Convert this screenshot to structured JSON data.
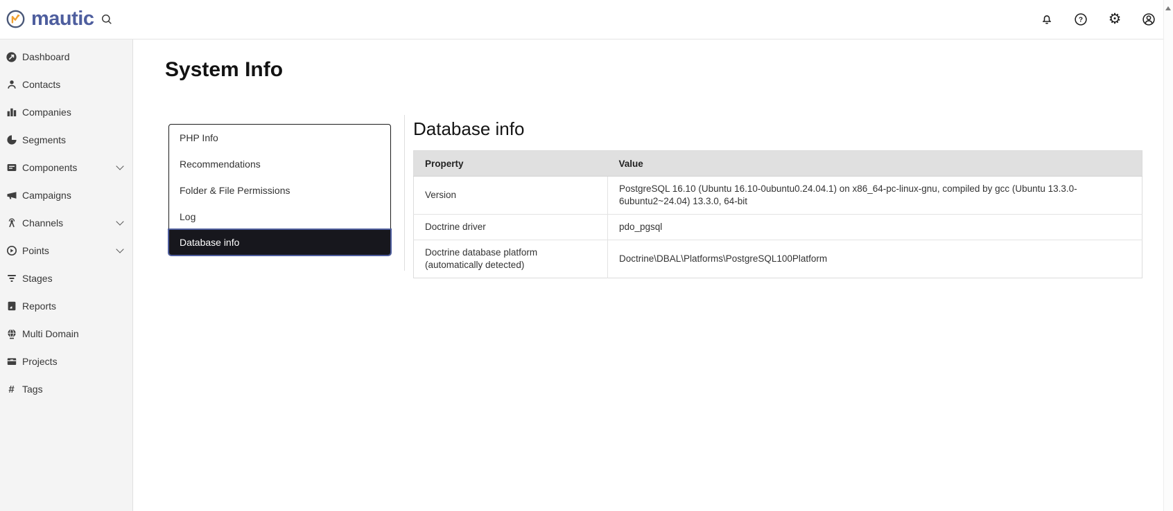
{
  "header": {
    "logo_text": "mautic",
    "icon_names": [
      "search-icon",
      "notifications-bell-icon",
      "help-icon",
      "settings-gear-icon",
      "account-icon"
    ]
  },
  "sidebar": {
    "items": [
      {
        "label": "Dashboard",
        "icon": "dashboard-gauge-icon",
        "has_submenu": false
      },
      {
        "label": "Contacts",
        "icon": "person-icon",
        "has_submenu": false
      },
      {
        "label": "Companies",
        "icon": "bar-chart-icon",
        "has_submenu": false
      },
      {
        "label": "Segments",
        "icon": "pie-chart-icon",
        "has_submenu": false
      },
      {
        "label": "Components",
        "icon": "card-icon",
        "has_submenu": true
      },
      {
        "label": "Campaigns",
        "icon": "megaphone-icon",
        "has_submenu": false
      },
      {
        "label": "Channels",
        "icon": "broadcast-icon",
        "has_submenu": true
      },
      {
        "label": "Points",
        "icon": "circle-arrow-icon",
        "has_submenu": true
      },
      {
        "label": "Stages",
        "icon": "funnel-icon",
        "has_submenu": false
      },
      {
        "label": "Reports",
        "icon": "report-doc-icon",
        "has_submenu": false
      },
      {
        "label": "Multi Domain",
        "icon": "globe-icon",
        "has_submenu": false
      },
      {
        "label": "Projects",
        "icon": "archive-box-icon",
        "has_submenu": false
      },
      {
        "label": "Tags",
        "icon": "hash-icon",
        "has_submenu": false
      }
    ]
  },
  "main": {
    "page_title": "System Info",
    "tabs": [
      {
        "label": "PHP Info",
        "selected": false
      },
      {
        "label": "Recommendations",
        "selected": false
      },
      {
        "label": "Folder & File Permissions",
        "selected": false
      },
      {
        "label": "Log",
        "selected": false
      },
      {
        "label": "Database info",
        "selected": true
      }
    ],
    "section_title": "Database info",
    "table": {
      "columns": [
        "Property",
        "Value"
      ],
      "rows": [
        {
          "property": "Version",
          "value": "PostgreSQL 16.10 (Ubuntu 16.10-0ubuntu0.24.04.1) on x86_64-pc-linux-gnu, compiled by gcc (Ubuntu 13.3.0-6ubuntu2~24.04) 13.3.0, 64-bit"
        },
        {
          "property": "Doctrine driver",
          "value": "pdo_pgsql"
        },
        {
          "property": "Doctrine database platform (automatically detected)",
          "value": "Doctrine\\DBAL\\Platforms\\PostgreSQL100Platform"
        }
      ]
    }
  },
  "colors": {
    "accent_blue": "#4e5d9d",
    "logo_indigo": "#4e5e9e",
    "logo_gold": "#f0a030",
    "selected_tab_bg": "#17171d",
    "table_header_bg": "#e0e0e0",
    "sidebar_bg": "#f4f4f4"
  }
}
